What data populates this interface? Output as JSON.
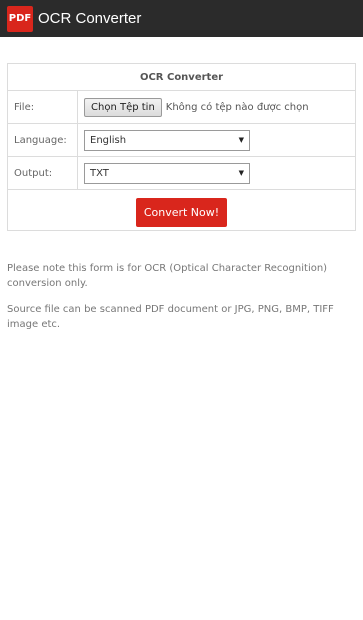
{
  "appbar": {
    "icon_text": "PDF",
    "title": "OCR Converter"
  },
  "form": {
    "header": "OCR Converter",
    "file": {
      "label": "File:",
      "button_label": "Chọn Tệp tin",
      "status": "Không có tệp nào được chọn"
    },
    "language": {
      "label": "Language:",
      "selected": "English"
    },
    "output": {
      "label": "Output:",
      "selected": "TXT"
    },
    "submit_label": "Convert Now!"
  },
  "notes": {
    "first": "Please note this form is for OCR (Optical Character Recognition) conversion only.",
    "second": "Source file can be scanned PDF document or JPG, PNG, BMP, TIFF image etc."
  },
  "colors": {
    "appbar": "#2b2b2b",
    "accent": "#d9261c"
  }
}
